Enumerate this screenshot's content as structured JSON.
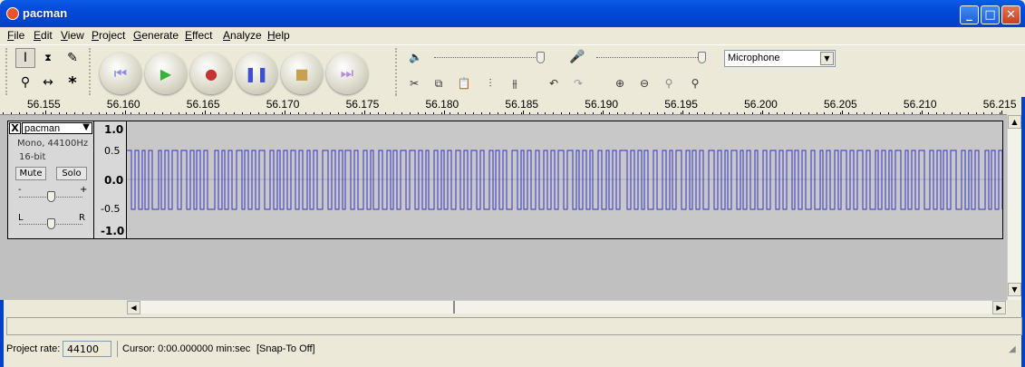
{
  "window": {
    "title": "pacman",
    "min_icon": "minimize-icon",
    "max_icon": "maximize-icon",
    "close_icon": "close-icon"
  },
  "menu": [
    "File",
    "Edit",
    "View",
    "Project",
    "Generate",
    "Effect",
    "Analyze",
    "Help"
  ],
  "tools": [
    "selection-tool",
    "envelope-tool",
    "draw-tool",
    "zoom-tool",
    "timeshift-tool",
    "multi-tool"
  ],
  "transport": [
    "skip-start",
    "play",
    "record",
    "pause",
    "stop",
    "skip-end"
  ],
  "mixer": {
    "input_source": "Microphone"
  },
  "ruler": {
    "ticks": [
      "56.155",
      "56.160",
      "56.165",
      "56.170",
      "56.175",
      "56.180",
      "56.185",
      "56.190",
      "56.195",
      "56.200",
      "56.205",
      "56.210",
      "56.215"
    ]
  },
  "track": {
    "name": "pacman",
    "info1": "Mono, 44100Hz",
    "info2": "16-bit",
    "mute": "Mute",
    "solo": "Solo",
    "gain_minus": "-",
    "gain_plus": "+",
    "pan_left": "L",
    "pan_right": "R",
    "close": "X"
  },
  "vruler": [
    "1.0",
    "0.5",
    "0.0",
    "-0.5",
    "-1.0"
  ],
  "status": {
    "rate_label": "Project rate:",
    "rate_value": "44100",
    "cursor": "Cursor: 0:00.000000 min:sec",
    "snap": "[Snap-To Off]"
  },
  "colors": {
    "waveform": "#3232c8",
    "titlebar": "#0349d8"
  }
}
